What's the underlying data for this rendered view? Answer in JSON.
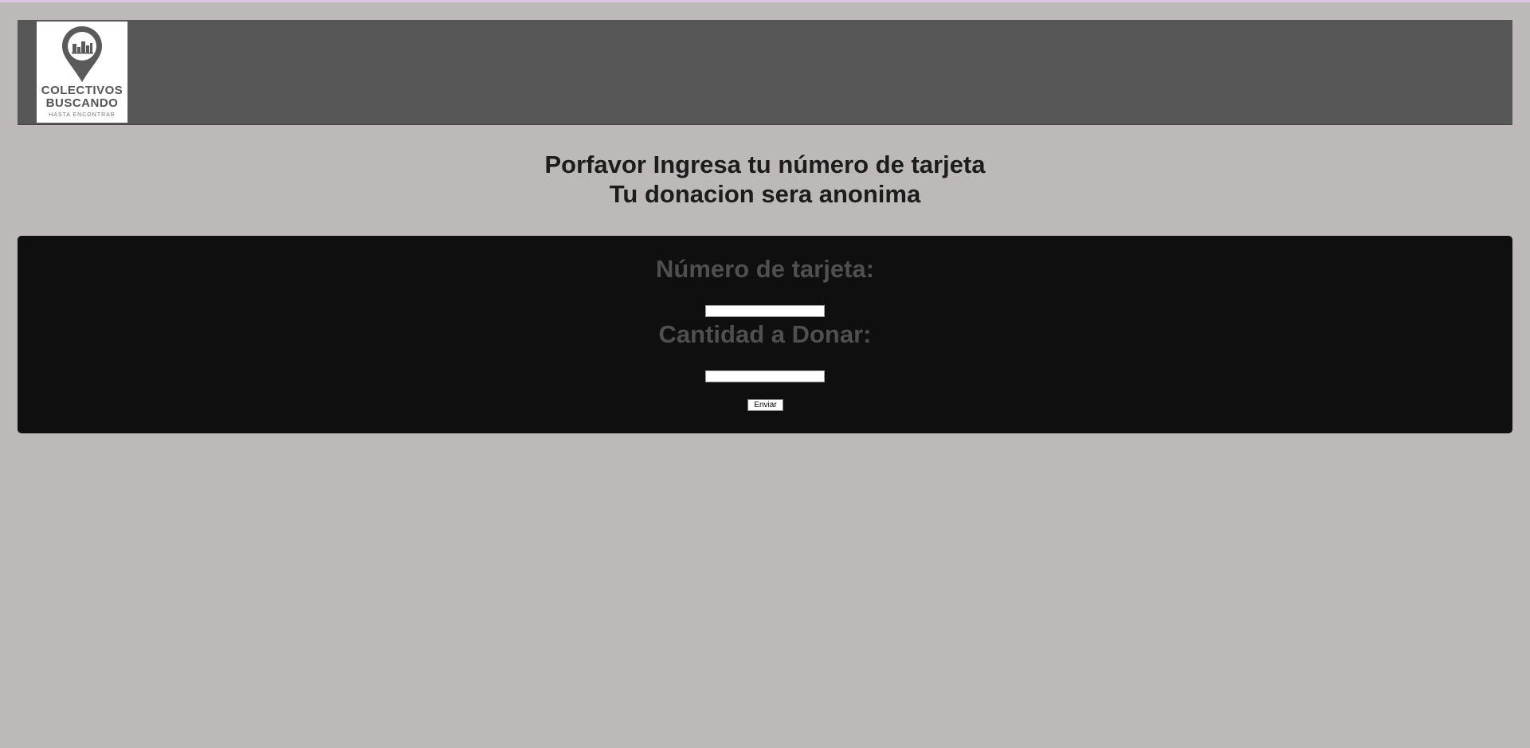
{
  "brand": {
    "logo_line1": "COLECTIVOS",
    "logo_line2": "BUSCANDO",
    "logo_tagline": "HASTA ENCONTRAR",
    "logo_icon": "map-pin-city-icon",
    "header_color": "#575757"
  },
  "heading": {
    "line1": "Porfavor Ingresa tu número de tarjeta",
    "line2": "Tu donacion sera anonima"
  },
  "form": {
    "card_label": "Número de tarjeta:",
    "card_value": "",
    "amount_label": "Cantidad a Donar:",
    "amount_value": "",
    "submit_label": "Enviar",
    "panel_color": "#0f0f0f",
    "background_color": "#bdb9b8"
  }
}
